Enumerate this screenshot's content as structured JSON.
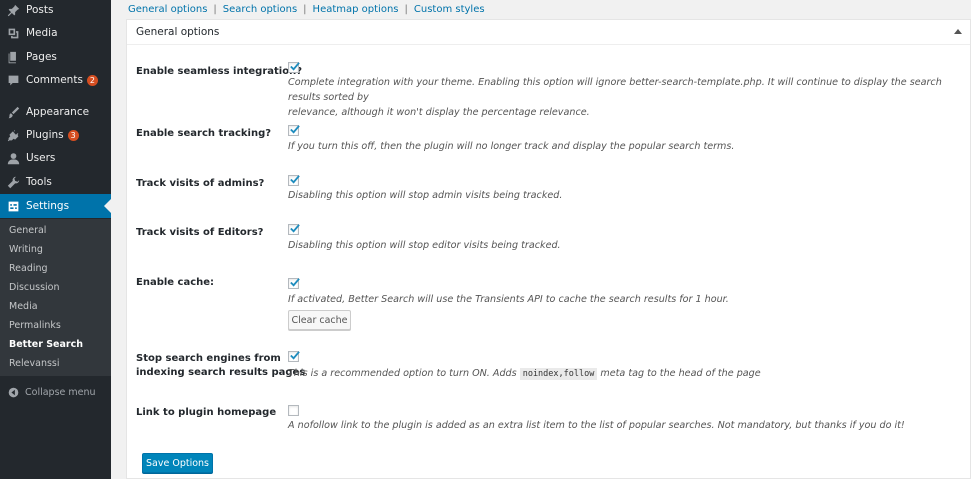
{
  "sidebar": {
    "items": [
      {
        "label": "Posts",
        "icon": "pin-icon"
      },
      {
        "label": "Media",
        "icon": "media-icon"
      },
      {
        "label": "Pages",
        "icon": "pages-icon"
      },
      {
        "label": "Comments",
        "icon": "comment-icon",
        "badge": "2"
      },
      {
        "label": "Appearance",
        "icon": "brush-icon"
      },
      {
        "label": "Plugins",
        "icon": "plugin-icon",
        "badge": "3"
      },
      {
        "label": "Users",
        "icon": "user-icon"
      },
      {
        "label": "Tools",
        "icon": "wrench-icon"
      },
      {
        "label": "Settings",
        "icon": "settings-icon",
        "active": true
      }
    ],
    "submenu": [
      "General",
      "Writing",
      "Reading",
      "Discussion",
      "Media",
      "Permalinks",
      "Better Search",
      "Relevanssi"
    ],
    "current_submenu": "Better Search",
    "collapse_label": "Collapse menu"
  },
  "tabs": [
    "General options",
    "Search options",
    "Heatmap options",
    "Custom styles"
  ],
  "postbox": {
    "title": "General options"
  },
  "options": [
    {
      "label": "Enable seamless integration?",
      "checked": true,
      "description_lines": [
        "Complete integration with your theme. Enabling this option will ignore better-search-template.php. It will continue to display the search results sorted by",
        "relevance, although it won't display the percentage relevance."
      ]
    },
    {
      "label": "Enable search tracking?",
      "checked": true,
      "description": "If you turn this off, then the plugin will no longer track and display the popular search terms."
    },
    {
      "label": "Track visits of admins?",
      "checked": true,
      "description": "Disabling this option will stop admin visits being tracked."
    },
    {
      "label": "Track visits of Editors?",
      "checked": true,
      "description": "Disabling this option will stop editor visits being tracked."
    },
    {
      "label": "Enable cache:",
      "checked": true,
      "description": "If activated, Better Search will use the Transients API to cache the search results for 1 hour.",
      "button": "Clear cache"
    },
    {
      "label_lines": [
        "Stop search engines from",
        "indexing search results pages"
      ],
      "checked": true,
      "description_before": "This is a recommended option to turn ON. Adds ",
      "description_code": "noindex,follow",
      "description_after": " meta tag to the head of the page"
    },
    {
      "label": "Link to plugin homepage",
      "checked": false,
      "description": "A nofollow link to the plugin is added as an extra list item to the list of popular searches. Not mandatory, but thanks if you do it!"
    }
  ],
  "save_button": "Save Options",
  "colors": {
    "sidebar_bg": "#23282d",
    "submenu_bg": "#32373c",
    "active_blue": "#0073aa",
    "primary_button": "#0085ba",
    "badge": "#d54e21"
  }
}
